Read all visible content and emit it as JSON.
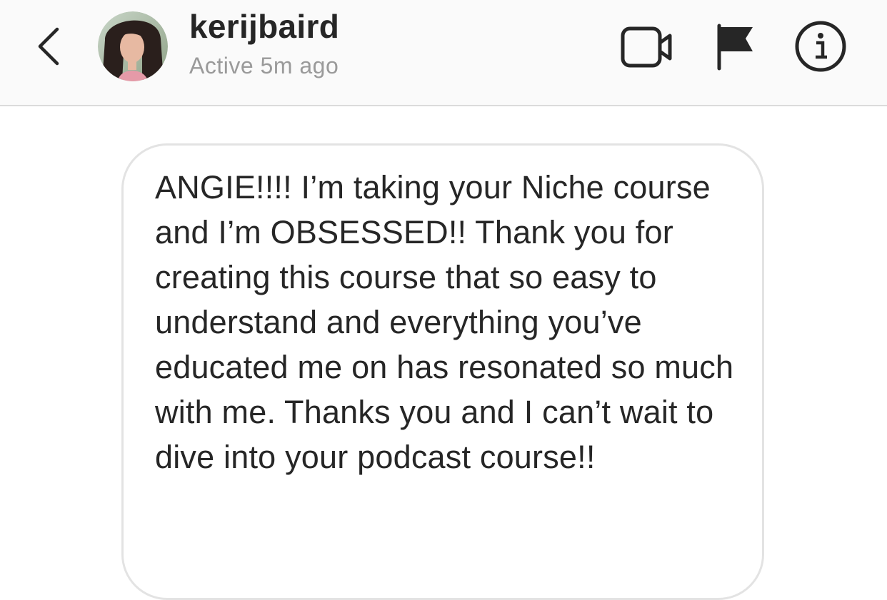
{
  "header": {
    "back_icon": "chevron-left-icon",
    "username": "kerijbaird",
    "status": "Active 5m ago",
    "actions": {
      "video_icon": "video-camera-icon",
      "flag_icon": "flag-icon",
      "info_icon": "info-icon"
    }
  },
  "conversation": {
    "messages": [
      {
        "text": "ANGIE!!!! I’m taking your Niche course and I’m OBSESSED!! Thank you for creating this course that so easy to understand and everything you’ve educated me on has resonated so much with me. Thanks you and I can’t wait to dive into your podcast course!!"
      }
    ]
  },
  "colors": {
    "header_bg": "#fafafa",
    "divider": "#dbdbdb",
    "text_primary": "#262626",
    "text_secondary": "#9a9a9a",
    "bubble_border": "#e3e3e3"
  }
}
